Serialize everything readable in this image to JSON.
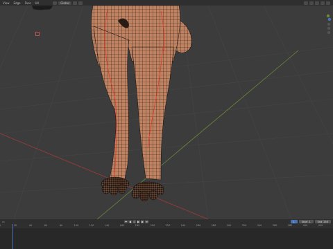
{
  "header": {
    "menus": [
      "View",
      "Edge",
      "Face",
      "UV"
    ],
    "transform_label": "Global"
  },
  "timeline": {
    "current_frame": "1",
    "start_label": "Start",
    "start_value": "1",
    "end_label": "End",
    "end_value": "250",
    "ruler_labels": [
      "0",
      "20",
      "40",
      "60",
      "80",
      "100",
      "120",
      "140",
      "160",
      "180",
      "200",
      "220",
      "240",
      "260",
      "280",
      "300",
      "320",
      "340",
      "360",
      "380",
      "400",
      "420",
      "440",
      "460"
    ]
  },
  "colors": {
    "viewport_bg": "#3c3c3c",
    "mesh_fill": "#c08260",
    "wire": "#1a1a1a",
    "seam": "#e23a2a",
    "x_axis": "#a33a3a",
    "y_axis": "#6a8a3a",
    "accent": "#4772b3"
  }
}
